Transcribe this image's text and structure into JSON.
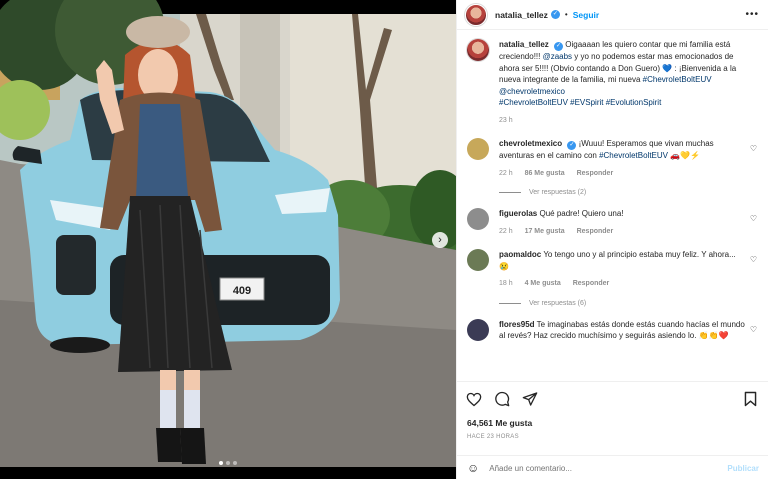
{
  "header": {
    "username": "natalia_tellez",
    "separator": "•",
    "follow_label": "Seguir",
    "more_label": "•••"
  },
  "caption": {
    "username": "natalia_tellez",
    "text_1": "Oigaaaan les quiero contar que mi familia está creciendo!!! ",
    "mention_1": "@zaabs",
    "text_2": " y yo no podemos estar mas emocionados de ahora ser 5!!!! (Obvio contando a Don Guero) 💙 : ¡Bienvenida a la nueva integrante de la familia, mi nueva ",
    "hashtag_1": "#ChevroletBoltEUV",
    "text_3": " ",
    "mention_2": "@chevroletmexico",
    "text_4": " ",
    "hashtags_2": "#ChevroletBoltEUV #EVSpirit #EvolutionSpirit",
    "time": "23 h"
  },
  "comments": [
    {
      "username": "chevroletmexico",
      "text": "¡Wuuu! Esperamos que vivan muchas aventuras en el camino con ",
      "tag": "#ChevroletBoltEUV",
      "text_after": " 🚗💛⚡",
      "time": "22 h",
      "likes": "86 Me gusta",
      "reply": "Responder",
      "view_replies": "Ver respuestas (2)",
      "avatar_color": "#c7a85a"
    },
    {
      "username": "figuerolas",
      "text": "Qué padre! Quiero una!",
      "time": "22 h",
      "likes": "17 Me gusta",
      "reply": "Responder",
      "avatar_color": "#8d8d8d"
    },
    {
      "username": "paomaldoc",
      "text": "Yo tengo uno y al principio estaba muy feliz. Y ahora... 😢",
      "time": "18 h",
      "likes": "4 Me gusta",
      "reply": "Responder",
      "view_replies": "Ver respuestas (6)",
      "avatar_color": "#6b7a55"
    },
    {
      "username": "flores95d",
      "text": "Te imaginabas estás donde estás cuando hacías el mundo al revés? Haz crecido muchísimo y seguirás asiendo lo. 👏👏❤️",
      "avatar_color": "#3b3b55"
    }
  ],
  "actions": {
    "likes": "64,561 Me gusta",
    "time_ago": "HACE 23 HORAS",
    "add_comment_placeholder": "Añade un comentario...",
    "publish_label": "Publicar"
  },
  "photo": {
    "plate_text": "409"
  },
  "colors": {
    "accent": "#0095f6",
    "tag": "#00376b",
    "muted": "#8e8e8e",
    "verified": "#3897f0",
    "car": "#8fcde0"
  },
  "icons": [
    "heart-icon",
    "comment-icon",
    "share-icon",
    "bookmark-icon",
    "emoji-icon",
    "verified-icon",
    "more-icon",
    "chevron-right-icon"
  ]
}
